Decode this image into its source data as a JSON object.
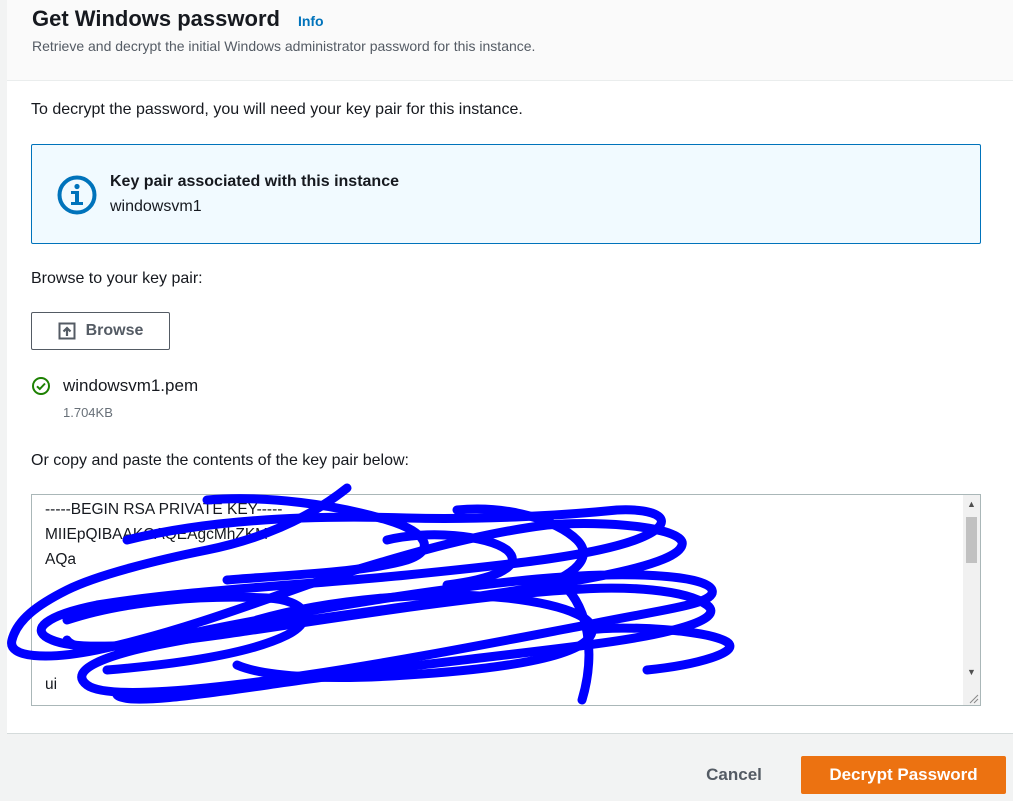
{
  "header": {
    "title": "Get Windows password",
    "info_link": "Info",
    "subtitle": "Retrieve and decrypt the initial Windows administrator password for this instance."
  },
  "intro_text": "To decrypt the password, you will need your key pair for this instance.",
  "alert": {
    "icon": "info-icon",
    "title": "Key pair associated with this instance",
    "value": "windowsvm1"
  },
  "browse": {
    "label": "Browse to your key pair:",
    "button_label": "Browse",
    "button_icon": "upload-icon"
  },
  "selected_file": {
    "status_icon": "check-circle-icon",
    "name": "windowsvm1.pem",
    "size": "1.704KB"
  },
  "paste": {
    "label": "Or copy and paste the contents of the key pair below:",
    "visible_lines": [
      "-----BEGIN RSA PRIVATE KEY-----",
      "MIIEpQIBAAKCAQEAgcMhZKM",
      "AQa",
      "",
      "",
      "",
      "",
      "",
      "ui"
    ],
    "redaction_color": "#0000ff"
  },
  "footer": {
    "cancel_label": "Cancel",
    "primary_label": "Decrypt Password"
  },
  "colors": {
    "primary": "#ec7211",
    "link": "#0073bb",
    "alert_border": "#0073bb",
    "alert_bg": "#f1faff",
    "success": "#1d8102"
  }
}
